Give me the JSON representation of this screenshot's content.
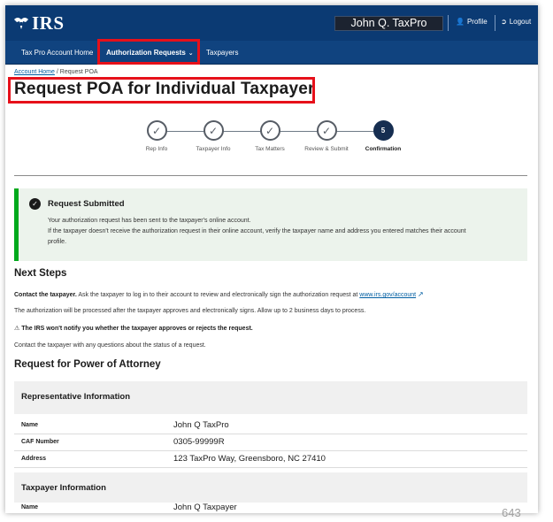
{
  "header": {
    "logo_text": "IRS",
    "user_name": "John Q. TaxPro",
    "profile_label": "Profile",
    "logout_label": "Logout"
  },
  "nav": {
    "items": [
      {
        "label": "Tax Pro Account Home"
      },
      {
        "label": "Authorization Requests"
      },
      {
        "label": "Taxpayers"
      }
    ]
  },
  "breadcrumb": {
    "home": "Account Home",
    "separator": "/",
    "current": "Request POA"
  },
  "page": {
    "title": "Request POA for Individual Taxpayer"
  },
  "stepper": {
    "steps": [
      {
        "label": "Rep Info",
        "status": "complete"
      },
      {
        "label": "Taxpayer Info",
        "status": "complete"
      },
      {
        "label": "Tax Matters",
        "status": "complete"
      },
      {
        "label": "Review & Submit",
        "status": "complete"
      },
      {
        "label": "Confirmation",
        "status": "current",
        "number": "5"
      }
    ]
  },
  "alert": {
    "title": "Request Submitted",
    "line1": "Your authorization request has been sent to the taxpayer's online account.",
    "line2": "If the taxpayer doesn't receive the authorization request in their online account, verify the taxpayer name and address you entered matches their account",
    "line3": "profile."
  },
  "next_steps": {
    "heading": "Next Steps",
    "contact_bold": "Contact the taxpayer.",
    "contact_text": " Ask the taxpayer to log in to their account to review and electronically sign the authorization request at ",
    "contact_link": "www.irs.gov/account",
    "processing": "The authorization will be processed after the taxpayer approves and electronically signs. Allow up to 2 business days to process.",
    "warning": "The IRS won't notify you whether the taxpayer approves or rejects the request.",
    "questions": "Contact the taxpayer with any questions about the status of a request."
  },
  "poa": {
    "heading": "Request for Power of Attorney",
    "rep_section": "Representative Information",
    "rep_rows": [
      {
        "label": "Name",
        "value": "John Q TaxPro"
      },
      {
        "label": "CAF Number",
        "value": "0305-99999R"
      },
      {
        "label": "Address",
        "value": "123 TaxPro Way, Greensboro, NC 27410"
      }
    ],
    "taxpayer_section": "Taxpayer Information",
    "taxpayer_rows": [
      {
        "label": "Name",
        "value": "John Q Taxpayer"
      }
    ]
  },
  "page_number": "643",
  "colors": {
    "header_blue": "#0b3a73",
    "nav_blue": "#10437f",
    "highlight_red": "#e6101a",
    "success_green": "#00a91c",
    "step_current": "#162e51"
  }
}
